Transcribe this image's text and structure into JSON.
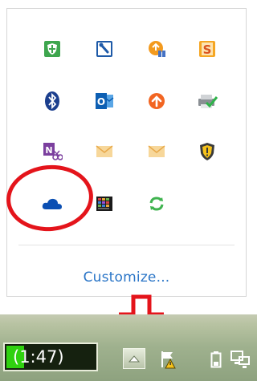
{
  "overflow": {
    "icons": [
      {
        "name": "green-shield-app-icon",
        "row": 1,
        "col": 1
      },
      {
        "name": "wrench-tool-icon",
        "row": 1,
        "col": 2
      },
      {
        "name": "orange-update-icon",
        "row": 1,
        "col": 3
      },
      {
        "name": "orange-s-app-icon",
        "row": 1,
        "col": 4
      },
      {
        "name": "bluetooth-icon",
        "row": 2,
        "col": 1
      },
      {
        "name": "outlook-icon",
        "row": 2,
        "col": 2
      },
      {
        "name": "orange-upload-icon",
        "row": 2,
        "col": 3
      },
      {
        "name": "printer-check-icon",
        "row": 2,
        "col": 4
      },
      {
        "name": "onenote-clip-icon",
        "row": 3,
        "col": 1
      },
      {
        "name": "mail-envelope-icon",
        "row": 3,
        "col": 2
      },
      {
        "name": "mail-envelope-icon-2",
        "row": 3,
        "col": 3
      },
      {
        "name": "security-warning-shield-icon",
        "row": 3,
        "col": 4
      },
      {
        "name": "onedrive-cloud-icon",
        "row": 4,
        "col": 1
      },
      {
        "name": "graphics-grid-icon",
        "row": 4,
        "col": 2
      },
      {
        "name": "green-sync-icon",
        "row": 4,
        "col": 3
      }
    ],
    "customize_label": "Customize..."
  },
  "taskbar": {
    "battery_text": "(1:47)",
    "icons": [
      "show-hidden-icons-button",
      "action-center-flag-icon",
      "battery-icon",
      "network-icon"
    ]
  },
  "colors": {
    "annotation": "#e4141b",
    "link": "#2a75c7",
    "taskbar": "#9fb18e"
  }
}
